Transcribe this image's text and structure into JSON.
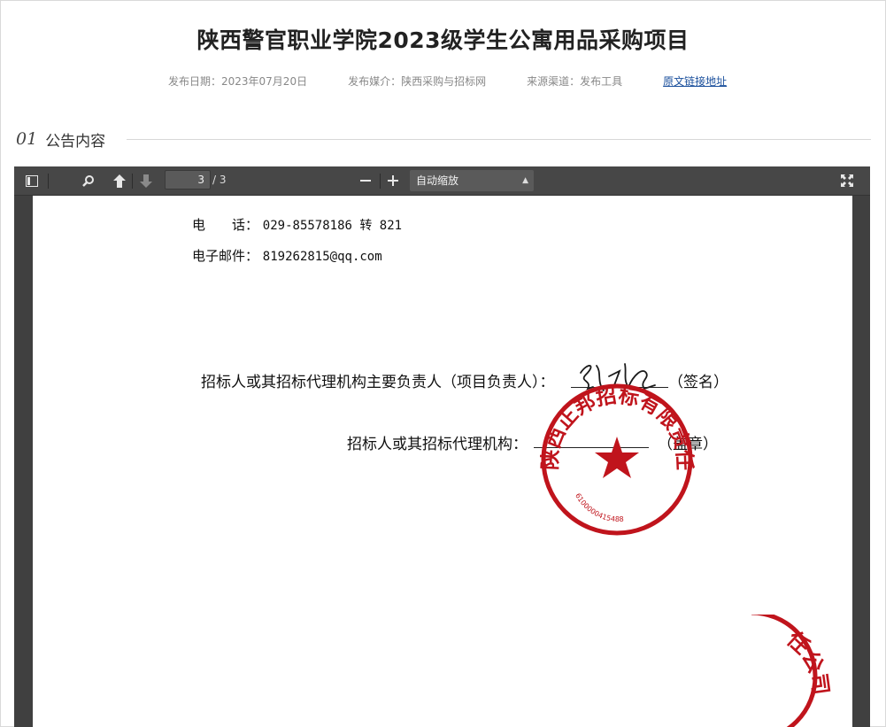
{
  "header": {
    "title": "陕西警官职业学院2023级学生公寓用品采购项目",
    "publish_date": "发布日期：2023年07月20日",
    "media": "发布媒介：陕西采购与招标网",
    "channel": "来源渠道：发布工具",
    "source_link": "原文链接地址"
  },
  "section": {
    "number": "01",
    "title": "公告内容"
  },
  "pdf_viewer": {
    "current_page": "3",
    "total_pages": "/ 3",
    "zoom": "自动缩放",
    "icons": [
      "sidebar-toggle-icon",
      "search-icon",
      "previous-page-icon",
      "next-page-icon",
      "zoom-out-icon",
      "zoom-in-icon",
      "fullscreen-icon"
    ]
  },
  "document": {
    "phone_label": "电　　话：",
    "phone_value": "029-85578186 转 821",
    "email_label": "电子邮件：",
    "email_value": "819262815@qq.com",
    "responsible_label": "招标人或其招标代理机构主要负责人（项目负责人）：",
    "sign_suffix": "（签名）",
    "org_label": "招标人或其招标代理机构：",
    "stamp_suffix": "（盖章）",
    "seal_text": "陕西正邦招标有限责任公司",
    "seal_number": "6100000415488",
    "seal2_text": "任公司"
  },
  "colors": {
    "seal": "#c0141c",
    "toolbar": "#474747",
    "viewer_bg": "#404040",
    "link": "#1a4f9c"
  }
}
